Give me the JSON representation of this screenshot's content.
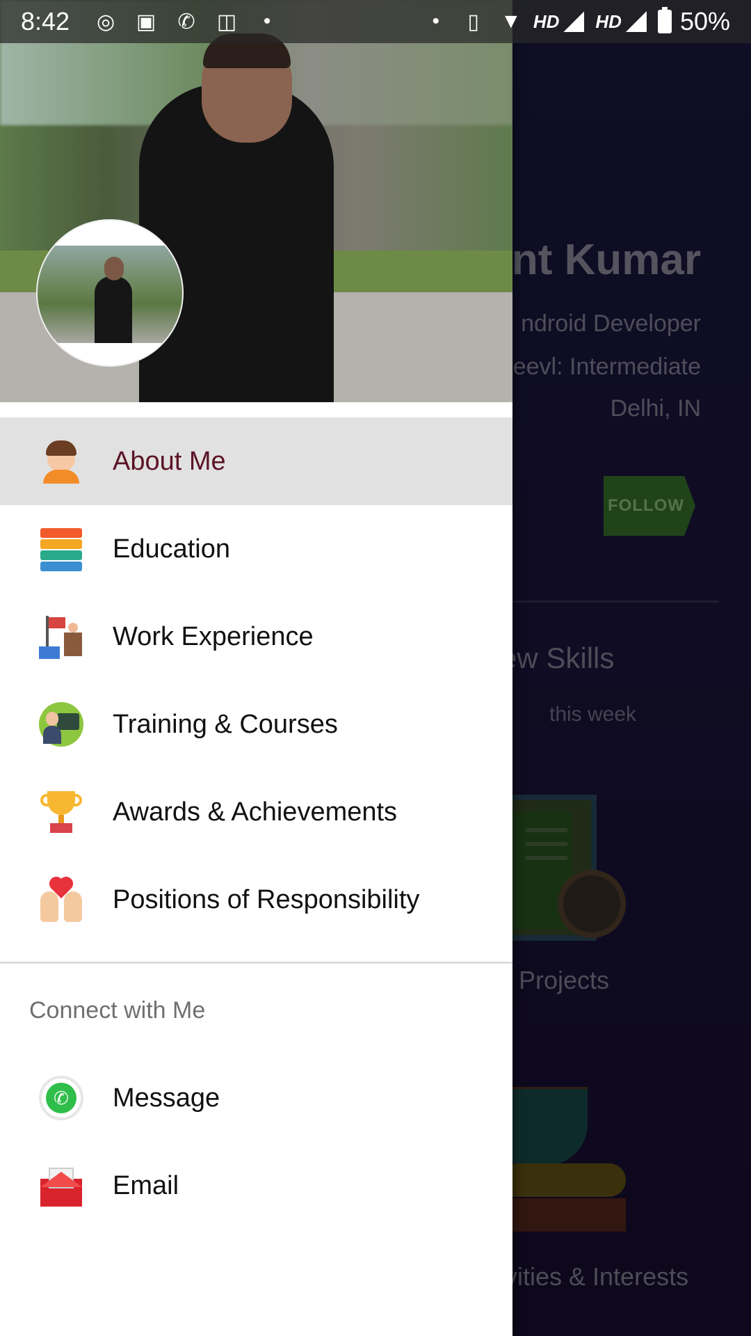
{
  "status_bar": {
    "time": "8:42",
    "left_icons": [
      "radio-icon",
      "image-icon",
      "whatsapp-icon",
      "instagram-icon",
      "dot-icon"
    ],
    "hd1": "HD",
    "hd2": "HD",
    "battery": "50%"
  },
  "background_profile": {
    "name": "ant Kumar",
    "role": "ndroid Developer",
    "level": "eevl: Intermediate",
    "location": "Delhi, IN",
    "follow_label": "FOLLOW",
    "skills_heading": "ew Skills",
    "skills_sub": "this week",
    "projects_heading": "Projects",
    "interests_heading": "vities & Interests"
  },
  "drawer": {
    "menu": [
      {
        "label": "About Me",
        "icon": "boy-avatar-icon",
        "active": true
      },
      {
        "label": "Education",
        "icon": "books-icon"
      },
      {
        "label": "Work Experience",
        "icon": "work-desk-icon"
      },
      {
        "label": "Training & Courses",
        "icon": "teacher-icon"
      },
      {
        "label": "Awards & Achievements",
        "icon": "trophy-icon"
      },
      {
        "label": "Positions of Responsibility",
        "icon": "helping-hands-icon"
      }
    ],
    "connect_title": "Connect with Me",
    "connect": [
      {
        "label": "Message",
        "icon": "whatsapp-icon"
      },
      {
        "label": "Email",
        "icon": "email-icon"
      }
    ]
  },
  "colors": {
    "active_item_bg": "#e1e1e1",
    "active_item_text": "#5b1326",
    "background_app": "#1c1640",
    "follow_badge": "#3c7a31"
  }
}
